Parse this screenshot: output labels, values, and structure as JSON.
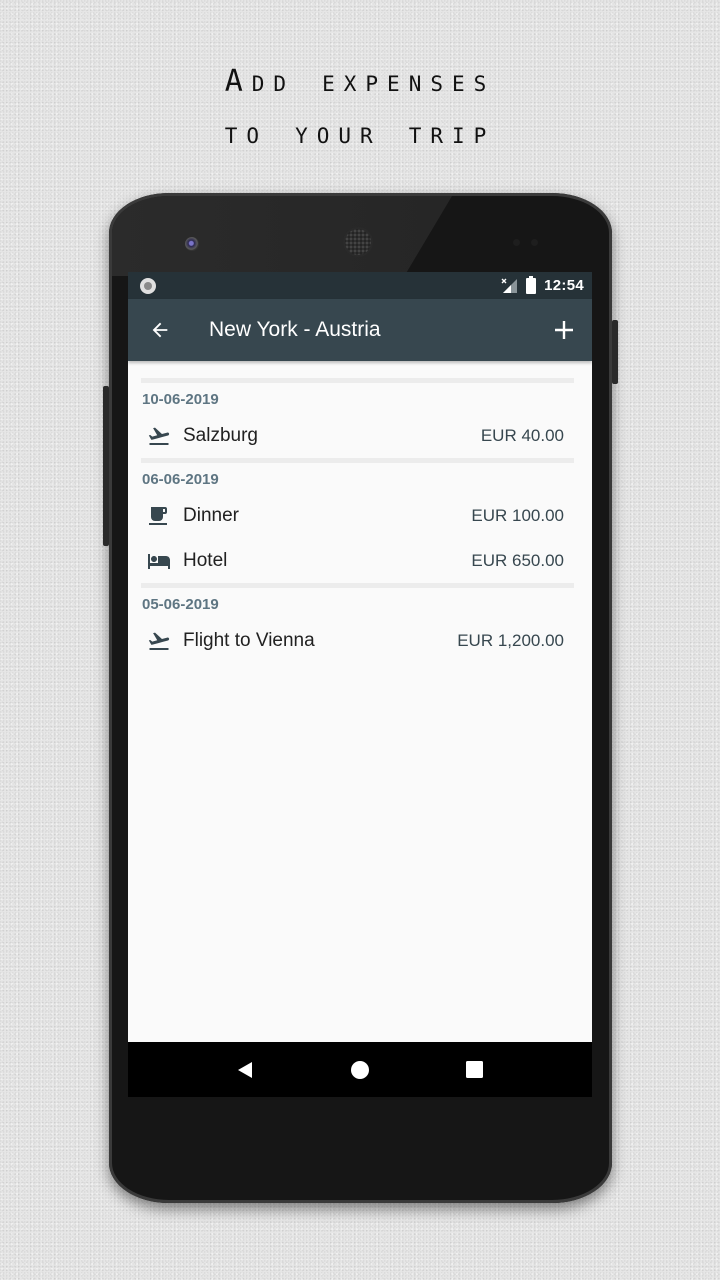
{
  "promo": {
    "line1": "Add expenses",
    "line2": "to your trip"
  },
  "status_bar": {
    "time": "12:54",
    "icons": [
      "notification-dot-icon",
      "signal-no-data-icon",
      "battery-full-icon"
    ]
  },
  "app_bar": {
    "title": "New York - Austria",
    "back_icon": "arrow-back-icon",
    "add_icon": "plus-icon"
  },
  "colors": {
    "status_bar": "#263238",
    "app_bar": "#37474f",
    "date_header": "#5e7582",
    "background": "#fafafa"
  },
  "expense_groups": [
    {
      "date": "10-06-2019",
      "items": [
        {
          "icon": "flight-takeoff-icon",
          "name": "Salzburg",
          "amount": "EUR 40.00"
        }
      ]
    },
    {
      "date": "06-06-2019",
      "items": [
        {
          "icon": "coffee-cup-icon",
          "name": "Dinner",
          "amount": "EUR 100.00"
        },
        {
          "icon": "hotel-bed-icon",
          "name": "Hotel",
          "amount": "EUR 650.00"
        }
      ]
    },
    {
      "date": "05-06-2019",
      "items": [
        {
          "icon": "flight-takeoff-icon",
          "name": "Flight to Vienna",
          "amount": "EUR 1,200.00"
        }
      ]
    }
  ],
  "nav_bar": {
    "buttons": [
      "back-triangle-icon",
      "home-circle-icon",
      "recents-square-icon"
    ]
  }
}
